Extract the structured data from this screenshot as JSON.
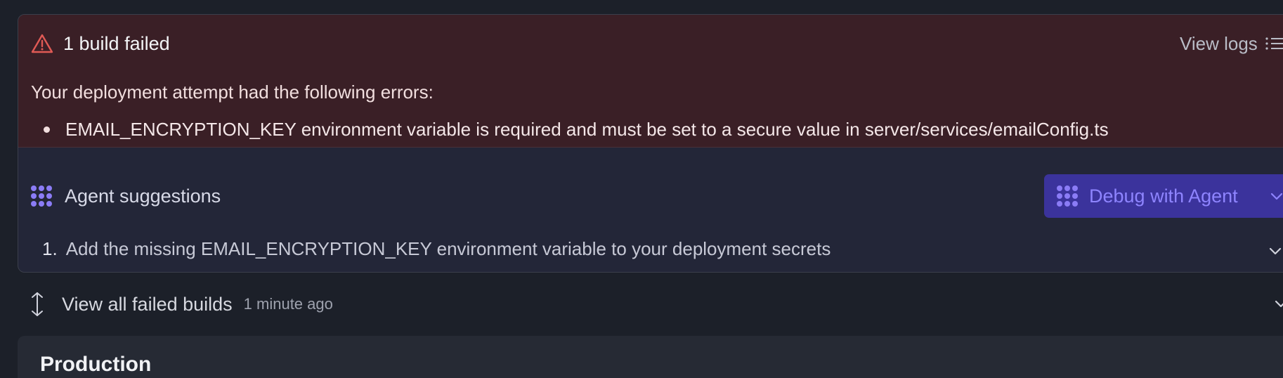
{
  "error": {
    "title": "1 build failed",
    "view_logs": "View logs",
    "intro": "Your deployment attempt had the following errors:",
    "items": [
      "EMAIL_ENCRYPTION_KEY environment variable is required and must be set to a secure value in server/services/emailConfig.ts"
    ],
    "icon": "warning-triangle-icon",
    "logs_icon": "list-icon"
  },
  "suggestions": {
    "title": "Agent suggestions",
    "debug_button": "Debug with Agent",
    "items": [
      {
        "number": "1.",
        "text": "Add the missing EMAIL_ENCRYPTION_KEY environment variable to your deployment secrets"
      }
    ],
    "icon": "agent-icon"
  },
  "failed_builds": {
    "label": "View all failed builds",
    "time": "1 minute ago",
    "icon": "expand-vertical-icon"
  },
  "next_section": {
    "title": "Production"
  },
  "colors": {
    "background": "#1c2029",
    "error_bg": "#3a1f26",
    "suggest_bg": "#232638",
    "accent": "#3b339c",
    "accent_text": "#8e84ff",
    "warning": "#e05a55"
  }
}
